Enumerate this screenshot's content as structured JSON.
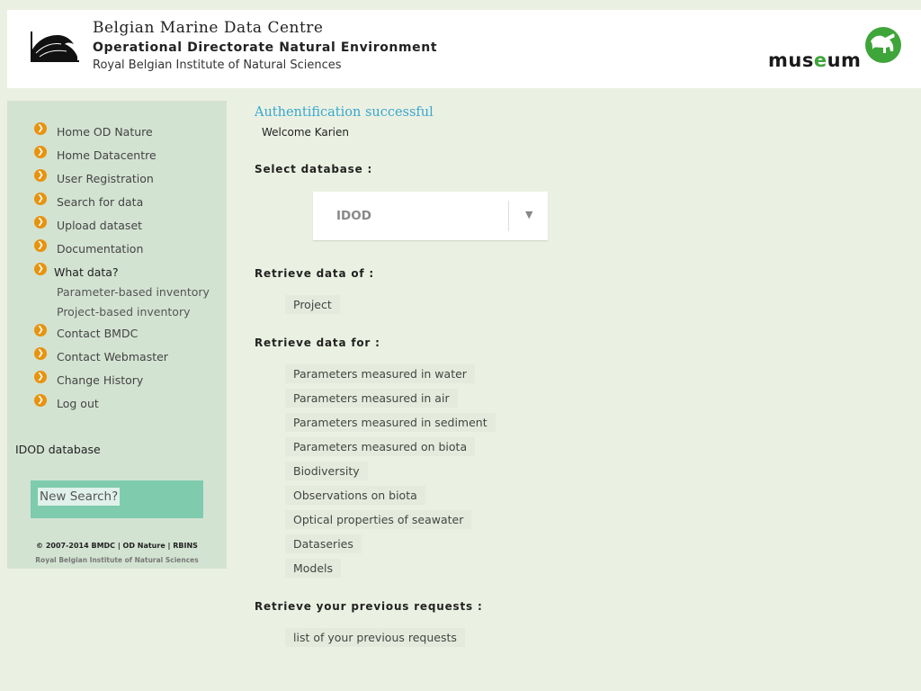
{
  "header": {
    "title1": "Belgian Marine Data Centre",
    "title2": "Operational Directorate Natural Environment",
    "title3": "Royal Belgian Institute of Natural Sciences",
    "museum_logo_text": "museum"
  },
  "sidebar": {
    "items": [
      {
        "label": "Home OD Nature"
      },
      {
        "label": "Home Datacentre"
      },
      {
        "label": "User Registration"
      },
      {
        "label": "Search for data"
      },
      {
        "label": "Upload dataset"
      },
      {
        "label": "Documentation"
      },
      {
        "label": "What data?"
      },
      {
        "label": "Contact BMDC"
      },
      {
        "label": "Contact Webmaster"
      },
      {
        "label": "Change History"
      },
      {
        "label": "Log out"
      }
    ],
    "sub_items": [
      {
        "label": "Parameter-based inventory"
      },
      {
        "label": "Project-based inventory"
      }
    ],
    "database_label": "IDOD database",
    "new_search_label": "New Search?",
    "copyright": "© 2007-2014 BMDC | OD Nature | RBINS",
    "institute": "Royal Belgian Institute of Natural Sciences"
  },
  "main": {
    "auth_message": "Authentification successful",
    "welcome": "Welcome Karien",
    "select_db_title": "Select database :",
    "selected_database": "IDOD",
    "retrieve_of_title": "Retrieve data of :",
    "retrieve_of_items": [
      {
        "label": "Project"
      }
    ],
    "retrieve_for_title": "Retrieve data for :",
    "retrieve_for_items": [
      {
        "label": "Parameters measured in water"
      },
      {
        "label": "Parameters measured in air"
      },
      {
        "label": "Parameters measured in sediment"
      },
      {
        "label": "Parameters measured on biota"
      },
      {
        "label": "Biodiversity"
      },
      {
        "label": "Observations on biota"
      },
      {
        "label": "Optical properties of seawater"
      },
      {
        "label": "Dataseries"
      },
      {
        "label": "Models"
      }
    ],
    "previous_title": "Retrieve your previous requests :",
    "previous_items": [
      {
        "label": "list of your previous requests"
      }
    ]
  },
  "colors": {
    "page_background": "#ebf1e2",
    "sidebar_background": "#d3e3d2",
    "bullet": "#e8930e",
    "auth_text": "#39a6cf",
    "new_search_box": "#7ecbae",
    "museum_green": "#3ea53a"
  },
  "icons": {
    "nav_bullet": "chevron-right-circle-icon",
    "select_arrow": "triangle-down-icon",
    "header_logo": "wave-logo-icon",
    "museum_logo": "dinosaur-logo-icon"
  }
}
